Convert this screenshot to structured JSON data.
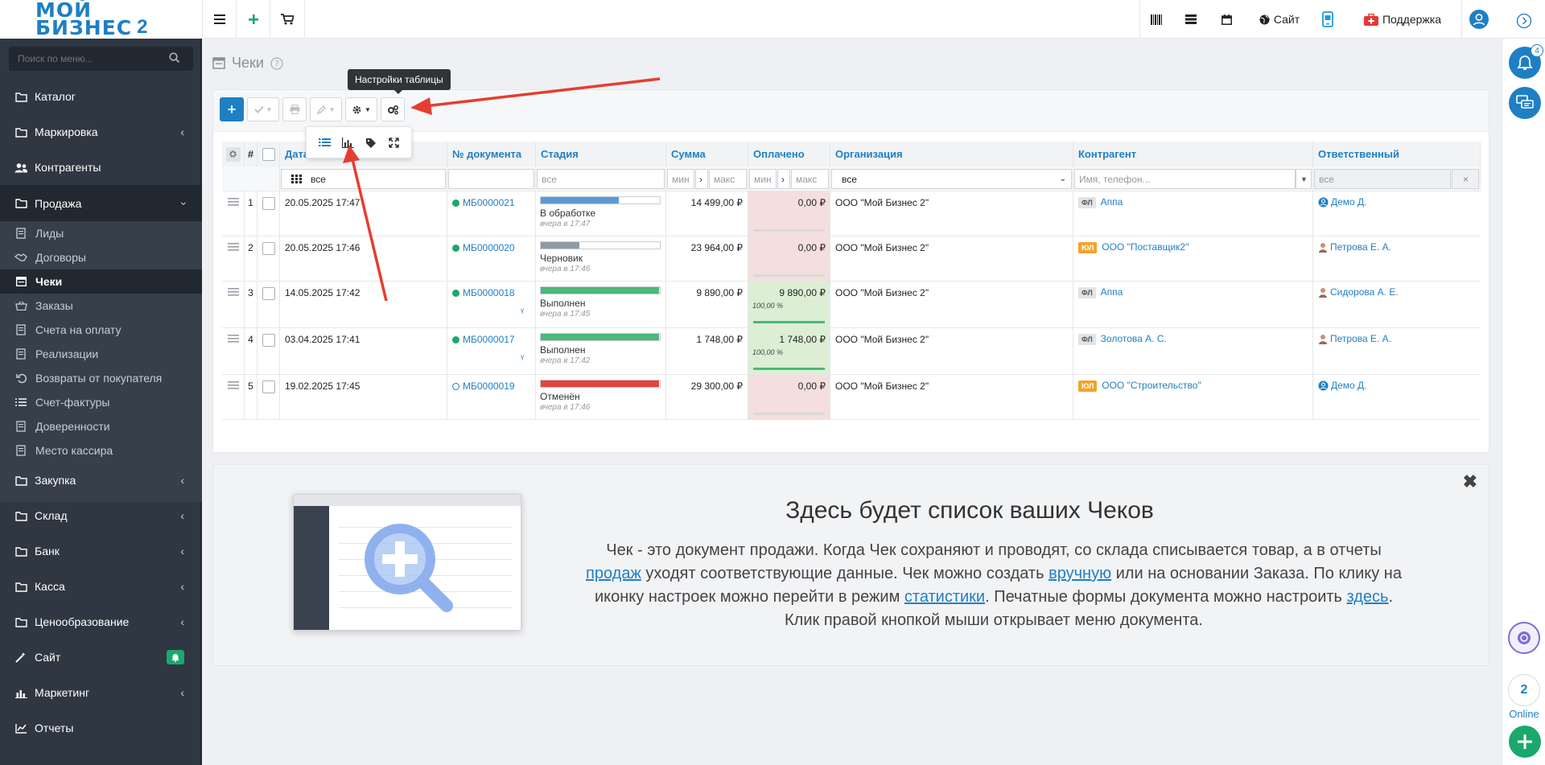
{
  "app": {
    "logo_line1": "МОЙ",
    "logo_line2": "БИЗНЕС",
    "logo_num": "2"
  },
  "topbar": {
    "site_label": "Сайт",
    "support_label": "Поддержка"
  },
  "sidebar": {
    "search_placeholder": "Поиск по меню...",
    "items": [
      {
        "label": "Каталог",
        "icon": "folder-icon",
        "has_chevron": false
      },
      {
        "label": "Маркировка",
        "icon": "folder-icon",
        "has_chevron": true
      },
      {
        "label": "Контрагенты",
        "icon": "users-icon",
        "has_chevron": false
      },
      {
        "label": "Продажа",
        "icon": "folder-icon",
        "has_chevron": true,
        "expanded": true
      },
      {
        "label": "Закупка",
        "icon": "folder-icon",
        "has_chevron": true
      },
      {
        "label": "Склад",
        "icon": "folder-icon",
        "has_chevron": true
      },
      {
        "label": "Банк",
        "icon": "folder-icon",
        "has_chevron": true
      },
      {
        "label": "Касса",
        "icon": "folder-icon",
        "has_chevron": true
      },
      {
        "label": "Ценообразование",
        "icon": "folder-icon",
        "has_chevron": true
      },
      {
        "label": "Сайт",
        "icon": "magic-wand-icon",
        "has_badge": true
      },
      {
        "label": "Маркетинг",
        "icon": "chart-bar-icon",
        "has_chevron": true
      },
      {
        "label": "Отчеты",
        "icon": "line-chart-icon",
        "has_chevron": false
      }
    ],
    "sub_items": [
      {
        "label": "Лиды",
        "icon": "document-icon"
      },
      {
        "label": "Договоры",
        "icon": "handshake-icon"
      },
      {
        "label": "Чеки",
        "icon": "receipt-icon",
        "active": true
      },
      {
        "label": "Заказы",
        "icon": "basket-icon"
      },
      {
        "label": "Счета на оплату",
        "icon": "document-icon"
      },
      {
        "label": "Реализации",
        "icon": "document-icon"
      },
      {
        "label": "Возвраты от покупателя",
        "icon": "undo-icon"
      },
      {
        "label": "Счет-фактуры",
        "icon": "list-icon"
      },
      {
        "label": "Доверенности",
        "icon": "document-icon"
      },
      {
        "label": "Место кассира",
        "icon": "document-icon"
      }
    ]
  },
  "rail": {
    "notifications_count": "4",
    "online_count": "2",
    "online_label": "Online"
  },
  "page": {
    "title": "Чеки",
    "tooltip": "Настройки таблицы"
  },
  "table": {
    "headers": {
      "num": "#",
      "date": "Дата",
      "doc": "№ документа",
      "stage": "Стадия",
      "sum": "Сумма",
      "paid": "Оплачено",
      "org": "Организация",
      "contractor": "Контрагент",
      "responsible": "Ответственный"
    },
    "filters": {
      "date": "все",
      "stage": "все",
      "sum_min": "мин",
      "sum_max": "макс",
      "paid_min": "мин",
      "paid_max": "макс",
      "org": "все",
      "contractor": "Имя, телефон...",
      "responsible": "все"
    },
    "rows": [
      {
        "n": "1",
        "date": "20.05.2025 17:47",
        "doc": "МБ0000021",
        "dot": "filled",
        "stage": "В обработке",
        "stage_time": "вчера в 17:47",
        "stage_color": "#5b9bd5",
        "stage_fill": 0.66,
        "sum": "14 499,00 ₽",
        "paid": "0,00 ₽",
        "paid_pct": "",
        "paid_state": "unpaid",
        "org": "ООО \"Мой Бизнес 2\"",
        "ctype": "ФЛ",
        "contractor": "Аппа",
        "resp": "Демо Д.",
        "resp_icon": "user-circle-icon"
      },
      {
        "n": "2",
        "date": "20.05.2025 17:46",
        "doc": "МБ0000020",
        "dot": "filled",
        "stage": "Черновик",
        "stage_time": "вчера в 17:46",
        "stage_color": "#8e9ba6",
        "stage_fill": 0.33,
        "sum": "23 964,00 ₽",
        "paid": "0,00 ₽",
        "paid_pct": "",
        "paid_state": "unpaid",
        "org": "ООО \"Мой Бизнес 2\"",
        "ctype": "ЮЛ",
        "contractor": "ООО \"Поставщик2\"",
        "resp": "Петрова Е. А.",
        "resp_icon": "person-icon"
      },
      {
        "n": "3",
        "date": "14.05.2025 17:42",
        "doc": "МБ0000018",
        "dot": "filled",
        "stage": "Выполнен",
        "stage_time": "вчера в 17:45",
        "stage_color": "#4cb87a",
        "stage_fill": 1,
        "sum": "9 890,00 ₽",
        "paid": "9 890,00 ₽",
        "paid_pct": "100,00 %",
        "paid_state": "paid",
        "org": "ООО \"Мой Бизнес 2\"",
        "ctype": "ФЛ",
        "contractor": "Аппа",
        "resp": "Сидорова А. Е.",
        "resp_icon": "person-icon"
      },
      {
        "n": "4",
        "date": "03.04.2025 17:41",
        "doc": "МБ0000017",
        "dot": "filled",
        "stage": "Выполнен",
        "stage_time": "вчера в 17:42",
        "stage_color": "#4cb87a",
        "stage_fill": 1,
        "sum": "1 748,00 ₽",
        "paid": "1 748,00 ₽",
        "paid_pct": "100,00 %",
        "paid_state": "paid",
        "org": "ООО \"Мой Бизнес 2\"",
        "ctype": "ФЛ",
        "contractor": "Золотова А. С.",
        "resp": "Петрова Е. А.",
        "resp_icon": "person-icon"
      },
      {
        "n": "5",
        "date": "19.02.2025 17:45",
        "doc": "МБ0000019",
        "dot": "empty",
        "stage": "Отменён",
        "stage_time": "вчера в 17:46",
        "stage_color": "#e8433a",
        "stage_fill": 1,
        "sum": "29 300,00 ₽",
        "paid": "0,00 ₽",
        "paid_pct": "",
        "paid_state": "unpaid",
        "org": "ООО \"Мой Бизнес 2\"",
        "ctype": "ЮЛ",
        "contractor": "ООО \"Строительство\"",
        "resp": "Демо Д.",
        "resp_icon": "user-circle-icon"
      }
    ]
  },
  "info": {
    "title": "Здесь будет список ваших Чеков",
    "p1": "Чек - это документ продажи. Когда Чек сохраняют и проводят, со склада списывается товар, а в отчеты ",
    "l1": "продаж",
    "p2": " уходят соответствующие данные. Чек можно создать ",
    "l2": "вручную",
    "p3": " или на основании Заказа. По клику на иконку настроек можно перейти в режим ",
    "l3": "статистики",
    "p4": ". Печатные формы документа можно настроить ",
    "l4": "здесь",
    "p5": ". Клик правой кнопкой мыши открывает меню документа."
  },
  "colors": {
    "accent": "#1f7fc4",
    "sidebar": "#2f3742",
    "paid_green": "#dcefd5",
    "unpaid_red": "#f4dede",
    "arrow": "#e53e30"
  }
}
